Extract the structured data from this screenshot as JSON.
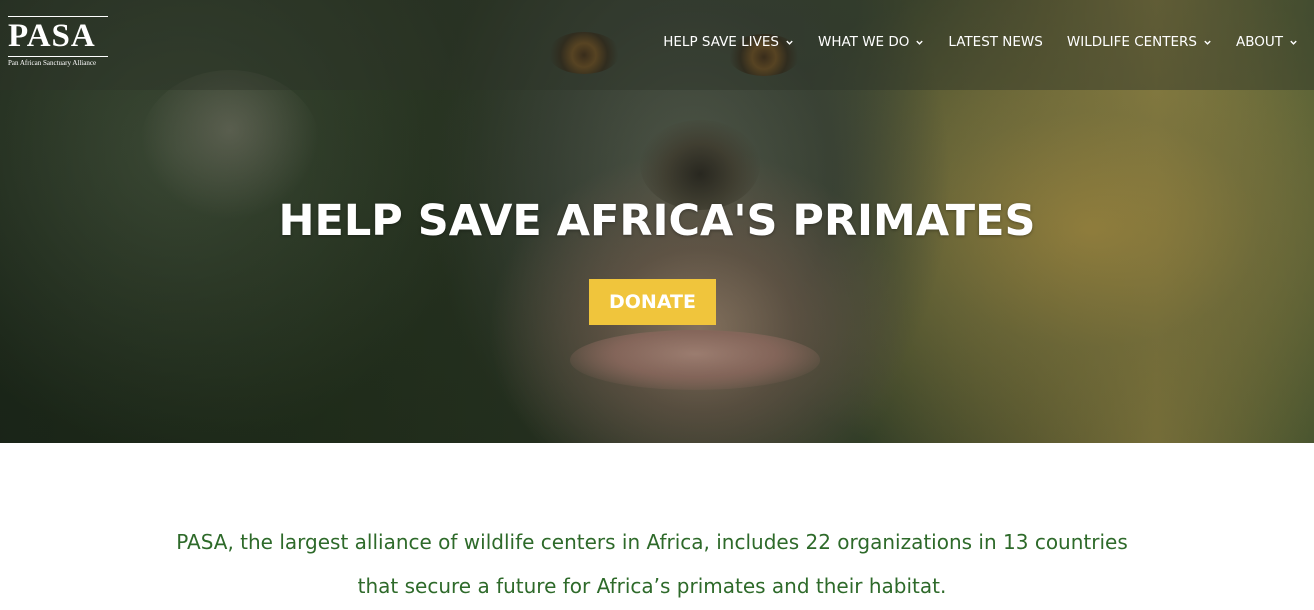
{
  "brand": {
    "logo_text": "PASA",
    "tagline": "Pan African Sanctuary Alliance"
  },
  "nav": {
    "items": [
      {
        "label": "HELP SAVE LIVES",
        "has_dropdown": true
      },
      {
        "label": "WHAT WE DO",
        "has_dropdown": true
      },
      {
        "label": "LATEST NEWS",
        "has_dropdown": false
      },
      {
        "label": "WILDLIFE CENTERS",
        "has_dropdown": true
      },
      {
        "label": "ABOUT",
        "has_dropdown": true
      }
    ]
  },
  "hero": {
    "title": "HELP SAVE AFRICA'S PRIMATES",
    "cta_label": "DONATE"
  },
  "intro": {
    "line1": "PASA, the largest alliance of wildlife centers in Africa, includes 22 organizations in 13 countries",
    "line2": "that secure a future for Africa’s primates and their habitat."
  },
  "colors": {
    "accent": "#f0c53c",
    "intro_text": "#2e6a2a",
    "nav_text": "#ffffff"
  }
}
